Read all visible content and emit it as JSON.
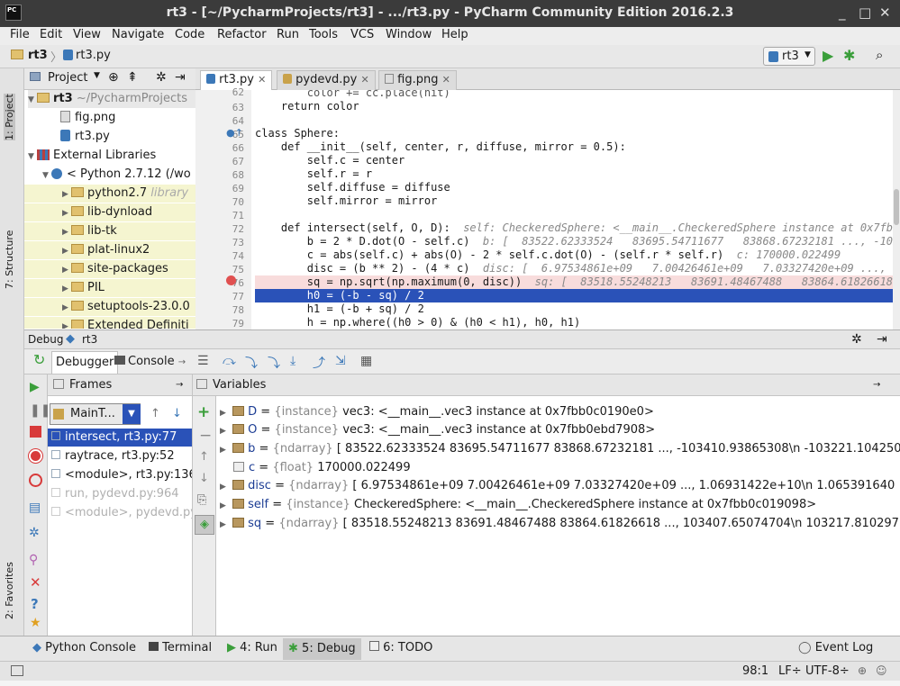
{
  "window": {
    "title": "rt3 - [~/PycharmProjects/rt3] - .../rt3.py - PyCharm Community Edition 2016.2.3",
    "app_icon": "PC"
  },
  "menu": [
    "File",
    "Edit",
    "View",
    "Navigate",
    "Code",
    "Refactor",
    "Run",
    "Tools",
    "VCS",
    "Window",
    "Help"
  ],
  "breadcrumb": {
    "project": "rt3",
    "file": "rt3.py"
  },
  "run_config": "rt3",
  "left_strip": {
    "project": "1: Project",
    "structure": "7: Structure",
    "favorites": "2: Favorites"
  },
  "project_panel": {
    "header": "Project",
    "tree": [
      {
        "label": "rt3",
        "suffix": "~/PycharmProjects",
        "kind": "root"
      },
      {
        "label": "fig.png",
        "kind": "file"
      },
      {
        "label": "rt3.py",
        "kind": "file"
      },
      {
        "label": "External Libraries",
        "kind": "libroot"
      },
      {
        "label": "< Python 2.7.12 (/wo",
        "kind": "sdk"
      },
      {
        "label": "python2.7",
        "suffix": "library",
        "kind": "lib"
      },
      {
        "label": "lib-dynload",
        "kind": "lib"
      },
      {
        "label": "lib-tk",
        "kind": "lib"
      },
      {
        "label": "plat-linux2",
        "kind": "lib"
      },
      {
        "label": "site-packages",
        "kind": "lib"
      },
      {
        "label": "PIL",
        "kind": "lib"
      },
      {
        "label": "setuptools-23.0.0",
        "kind": "lib"
      },
      {
        "label": "Extended Definiti",
        "kind": "lib"
      }
    ]
  },
  "editor": {
    "tabs": [
      {
        "label": "rt3.py",
        "active": true
      },
      {
        "label": "pydevd.py",
        "active": false
      },
      {
        "label": "fig.png",
        "active": false
      }
    ],
    "lines": [
      {
        "num": "62",
        "text": "        color += cc.place(hit)",
        "inline": ""
      },
      {
        "num": "63",
        "text": "    return color",
        "inline": ""
      },
      {
        "num": "64",
        "text": "",
        "inline": ""
      },
      {
        "num": "65",
        "text": "class Sphere:",
        "inline": ""
      },
      {
        "num": "66",
        "text": "    def __init__(self, center, r, diffuse, mirror = 0.5):",
        "inline": ""
      },
      {
        "num": "67",
        "text": "        self.c = center",
        "inline": ""
      },
      {
        "num": "68",
        "text": "        self.r = r",
        "inline": ""
      },
      {
        "num": "69",
        "text": "        self.diffuse = diffuse",
        "inline": ""
      },
      {
        "num": "70",
        "text": "        self.mirror = mirror",
        "inline": ""
      },
      {
        "num": "71",
        "text": "",
        "inline": ""
      },
      {
        "num": "72",
        "text": "    def intersect(self, O, D):",
        "inline": "  self: CheckeredSphere: <__main__.CheckeredSphere instance at 0x7fbb0c0"
      },
      {
        "num": "73",
        "text": "        b = 2 * D.dot(O - self.c)",
        "inline": "  b: [  83522.62333524   83695.54711677   83868.67232181 ..., -103410."
      },
      {
        "num": "74",
        "text": "        c = abs(self.c) + abs(O) - 2 * self.c.dot(O) - (self.r * self.r)",
        "inline": "  c: 170000.022499"
      },
      {
        "num": "75",
        "text": "        disc = (b ** 2) - (4 * c)",
        "inline": "  disc: [  6.97534861e+09   7.00426461e+09   7.03327420e+09 ...,   1.0"
      },
      {
        "num": "76",
        "text": "        sq = np.sqrt(np.maximum(0, disc))",
        "inline": "  sq: [  83518.55248213   83691.48467488   83864.61826618 ...,"
      },
      {
        "num": "77",
        "text": "        h0 = (-b - sq) / 2",
        "inline": ""
      },
      {
        "num": "78",
        "text": "        h1 = (-b + sq) / 2",
        "inline": ""
      },
      {
        "num": "79",
        "text": "        h = np.where((h0 > 0) & (h0 < h1), h0, h1)",
        "inline": ""
      }
    ]
  },
  "debug": {
    "title": "Debug",
    "config": "rt3",
    "tabs": [
      "Debugger",
      "Console"
    ],
    "frames_header": "Frames",
    "thread": "MainT...",
    "frames": [
      {
        "label": "intersect, rt3.py:77",
        "state": "selected"
      },
      {
        "label": "raytrace, rt3.py:52",
        "state": "normal"
      },
      {
        "label": "<module>, rt3.py:136",
        "state": "normal"
      },
      {
        "label": "run, pydevd.py:964",
        "state": "dim"
      },
      {
        "label": "<module>, pydevd.py",
        "state": "dim"
      }
    ],
    "variables_header": "Variables",
    "variables": [
      {
        "name": "D",
        "type": "{instance}",
        "value": "vec3: <__main__.vec3 instance at 0x7fbb0c0190e0>",
        "expandable": true
      },
      {
        "name": "O",
        "type": "{instance}",
        "value": "vec3: <__main__.vec3 instance at 0x7fbb0ebd7908>",
        "expandable": true
      },
      {
        "name": "b",
        "type": "{ndarray}",
        "value": "[  83522.62333524   83695.54711677   83868.67232181 ..., -103410.93865308\\n -103221.104250",
        "expandable": true
      },
      {
        "name": "c",
        "type": "{float}",
        "value": "170000.022499",
        "expandable": false
      },
      {
        "name": "disc",
        "type": "{ndarray}",
        "value": "[  6.97534861e+09   7.00426461e+09   7.03327420e+09 ...,   1.06931422e+10\\n  1.065391640",
        "expandable": true
      },
      {
        "name": "self",
        "type": "{instance}",
        "value": "CheckeredSphere: <__main__.CheckeredSphere instance at 0x7fbb0c019098>",
        "expandable": true
      },
      {
        "name": "sq",
        "type": "{ndarray}",
        "value": "[  83518.55248213   83691.48467488   83864.61826618 ...,  103407.65074704\\n  103217.810297",
        "expandable": true
      }
    ]
  },
  "bottom_tabs": [
    {
      "label": "Python Console",
      "active": false
    },
    {
      "label": "Terminal",
      "active": false
    },
    {
      "label": "4: Run",
      "active": false
    },
    {
      "label": "5: Debug",
      "active": true
    },
    {
      "label": "6: TODO",
      "active": false
    },
    {
      "label": "Event Log",
      "active": false
    }
  ],
  "status": {
    "position": "98:1",
    "line_sep": "LF÷",
    "encoding": "UTF-8÷"
  },
  "colors": {
    "accent": "#2a52b8",
    "run": "#3a9e3a",
    "stop": "#d83a3a"
  }
}
